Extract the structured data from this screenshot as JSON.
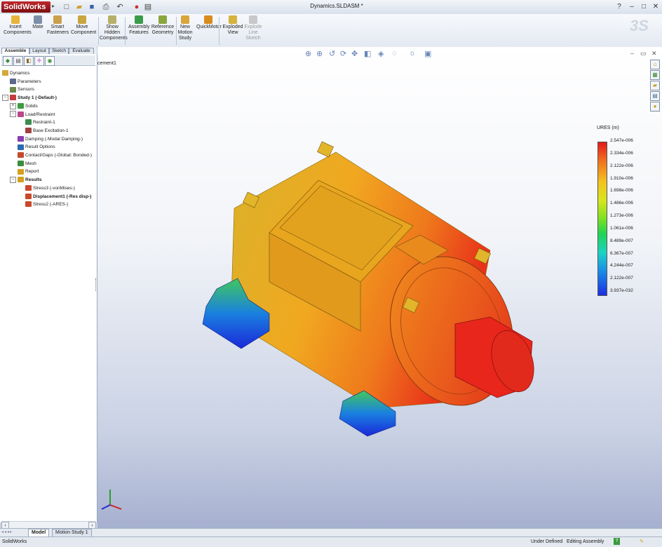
{
  "app": {
    "logo_text": "SolidWorks",
    "document_title": "Dynamics.SLDASM *",
    "help": "?"
  },
  "window_controls": {
    "minimize": "–",
    "restore": "□",
    "close": "✕"
  },
  "ribbon": [
    {
      "label": "Insert\nComponents",
      "color": "#e8b33a"
    },
    {
      "label": "Mate",
      "color": "#7d8ea8"
    },
    {
      "label": "Smart\nFasteners",
      "color": "#caa04a"
    },
    {
      "label": "Move\nComponent",
      "color": "#c9a740"
    },
    {
      "label": "Show\nHidden\nComponents",
      "color": "#b7b069"
    },
    {
      "label": "Assembly\nFeatures",
      "color": "#3a9b4a"
    },
    {
      "label": "Reference\nGeometry",
      "color": "#8aa63d"
    },
    {
      "label": "New\nMotion\nStudy",
      "color": "#d9a63a"
    },
    {
      "label": "QuickMotor",
      "color": "#d98b1e"
    },
    {
      "label": "Exploded\nView",
      "color": "#d6b33a"
    },
    {
      "label": "Explode\nLine\nSketch",
      "color": "#c8c8c8",
      "disabled": true
    }
  ],
  "command_tabs": [
    "Assemble",
    "Layout",
    "Sketch",
    "Evaluate"
  ],
  "active_command_tab": "Assemble",
  "tree": [
    {
      "label": "Dynamics",
      "indent": 0,
      "icon_color": "#d4a93a"
    },
    {
      "label": "Parameters",
      "indent": 1,
      "icon_color": "#5a6a8a"
    },
    {
      "label": "Sensors",
      "indent": 1,
      "icon_color": "#6a8a4a"
    },
    {
      "label": "Study 1 (-Default-)",
      "indent": 0,
      "bold": true,
      "expand": "−",
      "icon_color": "#c43c3c"
    },
    {
      "label": "Solids",
      "indent": 1,
      "expand": "+",
      "icon_color": "#3c9c3c"
    },
    {
      "label": "Load/Restraint",
      "indent": 1,
      "expand": "−",
      "icon_color": "#b84a8a"
    },
    {
      "label": "Restraint-1",
      "indent": 3,
      "icon_color": "#3c8c4c"
    },
    {
      "label": "Base Excitation-1",
      "indent": 3,
      "icon_color": "#a04040"
    },
    {
      "label": "Damping (-Modal Damping-)",
      "indent": 2,
      "icon_color": "#8a3cb0"
    },
    {
      "label": "Result Options",
      "indent": 2,
      "icon_color": "#2c6ab0"
    },
    {
      "label": "Contact/Gaps (-Global: Bonded-)",
      "indent": 2,
      "icon_color": "#c44a2c"
    },
    {
      "label": "Mesh",
      "indent": 2,
      "icon_color": "#3c8c3c"
    },
    {
      "label": "Report",
      "indent": 2,
      "icon_color": "#d4a020"
    },
    {
      "label": "Results",
      "indent": 1,
      "bold": true,
      "expand": "−",
      "icon_color": "#d4a020"
    },
    {
      "label": "Stress3 (-vonMises-)",
      "indent": 3,
      "icon_color": "#c84a2c"
    },
    {
      "label": "Displacement1 (-Res disp-)",
      "indent": 3,
      "bold": true,
      "icon_color": "#c84a2c"
    },
    {
      "label": "Stress2 (-ARES-)",
      "indent": 3,
      "icon_color": "#c84a2c"
    }
  ],
  "bottom_tabs": [
    "Model",
    "Motion Study 1"
  ],
  "active_bottom_tab": "Model",
  "status": {
    "app": "SolidWorks",
    "state": "Under Defined",
    "mode": "Editing Assembly",
    "help": "?"
  },
  "viewport": {
    "corner_label": "cement1"
  },
  "legend": {
    "title": "URES (m)",
    "values": [
      "2.547e-006",
      "2.334e-006",
      "2.122e-006",
      "1.910e-006",
      "1.698e-006",
      "1.486e-006",
      "1.273e-006",
      "1.061e-006",
      "8.489e-007",
      "6.367e-007",
      "4.244e-007",
      "2.122e-007",
      "3.937e-032"
    ]
  }
}
